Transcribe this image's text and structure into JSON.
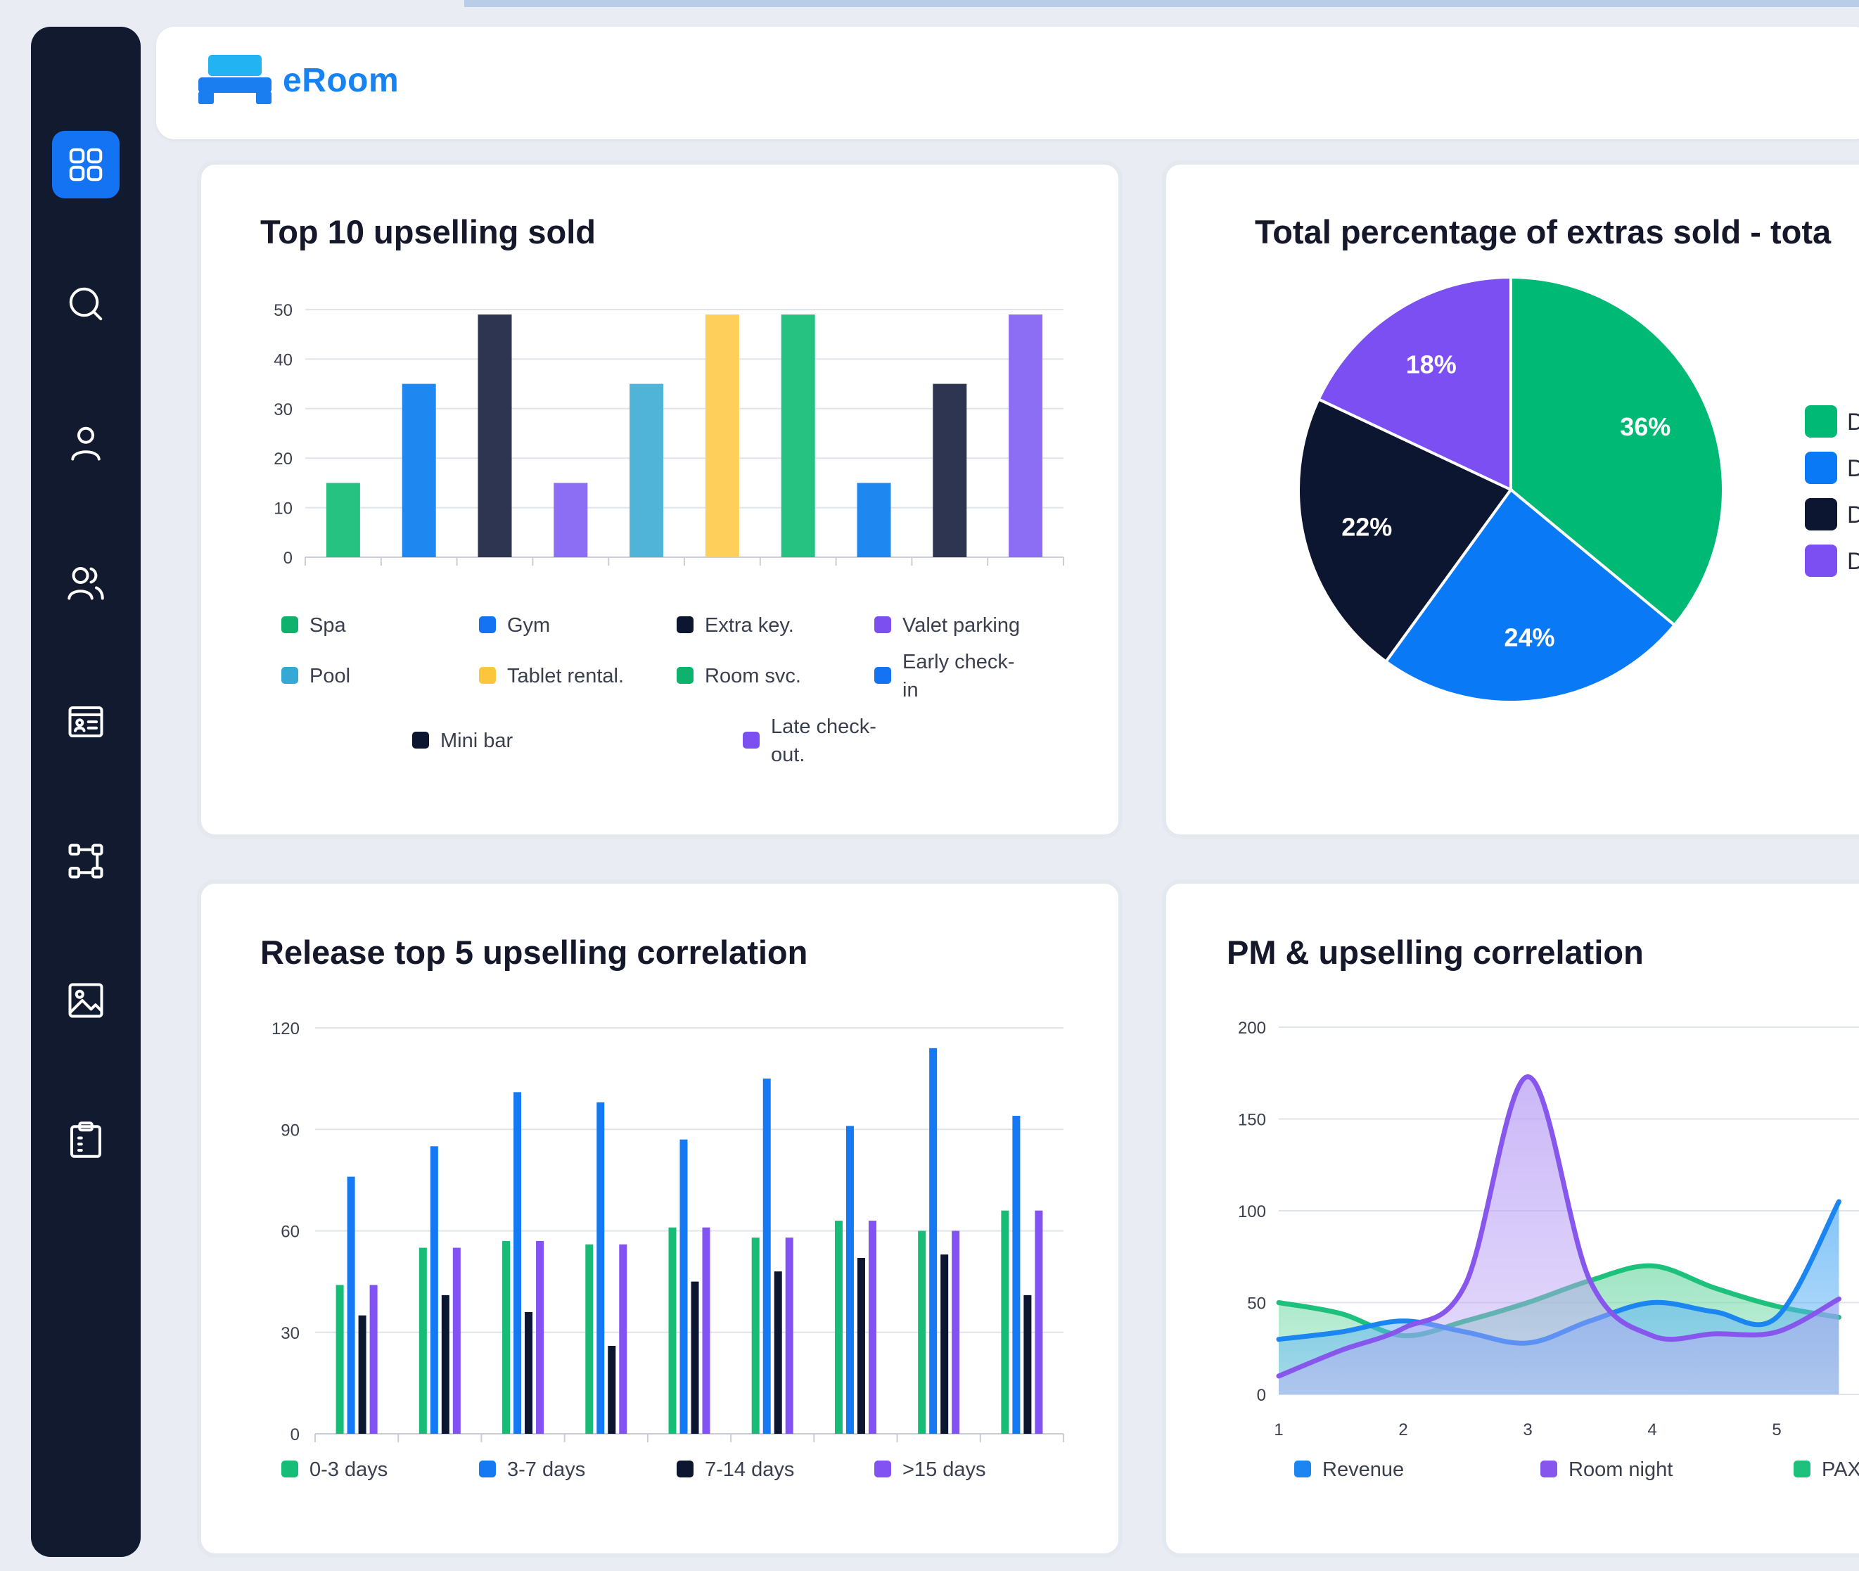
{
  "app": {
    "name": "eRoom"
  },
  "sidebar": {
    "items": [
      {
        "icon": "dashboard-icon",
        "active": true
      },
      {
        "icon": "search-icon"
      },
      {
        "icon": "user-icon"
      },
      {
        "icon": "users-icon"
      },
      {
        "icon": "id-card-icon"
      },
      {
        "icon": "workflow-icon"
      },
      {
        "icon": "image-icon"
      },
      {
        "icon": "clipboard-icon"
      }
    ]
  },
  "colors": {
    "accent": "#1473f2",
    "sidebar": "#111a2e",
    "green": "#26c281",
    "blue": "#1e88f0",
    "navy": "#2d3550",
    "purple": "#8c6ef5",
    "teal": "#4fb4d8",
    "yellow": "#fecf5a"
  },
  "cards": {
    "top10": {
      "title": "Top 10 upselling sold"
    },
    "extras": {
      "title": "Total percentage of extras sold - tota"
    },
    "release": {
      "title": "Release top 5 upselling correlation"
    },
    "pm": {
      "title": "PM & upselling correlation"
    }
  },
  "chart_data": [
    {
      "type": "bar",
      "title": "Top 10 upselling sold",
      "categories": [
        "Spa",
        "Gym",
        "Extra key.",
        "Valet parking",
        "Pool",
        "Tablet rental.",
        "Room svc.",
        "Early check-in",
        "Mini bar",
        "Late check-out."
      ],
      "values": [
        15,
        35,
        49,
        15,
        35,
        49,
        49,
        15,
        35,
        49
      ],
      "colors": [
        "#26c281",
        "#1e88f0",
        "#2d3550",
        "#8c6ef5",
        "#4fb4d8",
        "#fecf5a",
        "#26c281",
        "#1e88f0",
        "#2d3550",
        "#8c6ef5"
      ],
      "yticks": [
        "0",
        "10",
        "20",
        "30",
        "40",
        "50"
      ],
      "ylim": [
        0,
        50
      ],
      "grid": true,
      "legend": [
        {
          "label": "Spa",
          "color": "#0fb26c"
        },
        {
          "label": "Gym",
          "color": "#1473f2"
        },
        {
          "label": "Extra key.",
          "color": "#0d1630"
        },
        {
          "label": "Valet parking",
          "color": "#7c4ff0"
        },
        {
          "label": "Pool",
          "color": "#35a8d6"
        },
        {
          "label": "Tablet rental.",
          "color": "#fbc63c"
        },
        {
          "label": "Room svc.",
          "color": "#0fb26c"
        },
        {
          "label": "Early check-",
          "label2": "in",
          "color": "#1473f2"
        },
        {
          "label": "Mini bar",
          "color": "#0d1630"
        },
        {
          "label": "Late check-",
          "label2": "out.",
          "color": "#7c4ff0"
        }
      ]
    },
    {
      "type": "pie",
      "title": "Total percentage of extras sold - tota",
      "slices": [
        {
          "label": "36%",
          "value": 36,
          "color": "#00b975"
        },
        {
          "label": "24%",
          "value": 24,
          "color": "#0a79f5"
        },
        {
          "label": "22%",
          "value": 22,
          "color": "#0d1630"
        },
        {
          "label": "18%",
          "value": 18,
          "color": "#7b4ff1"
        }
      ],
      "legend": [
        {
          "label": "D",
          "color": "#00b975"
        },
        {
          "label": "D",
          "color": "#0a79f5"
        },
        {
          "label": "D",
          "color": "#0d1630"
        },
        {
          "label": "D",
          "color": "#7b4ff1"
        }
      ]
    },
    {
      "type": "bar",
      "title": "Release top 5 upselling correlation",
      "groups": 9,
      "series": [
        {
          "name": "0-3 days",
          "color": "#17bd76",
          "values": [
            44,
            55,
            57,
            56,
            61,
            58,
            63,
            60,
            66
          ]
        },
        {
          "name": "3-7 days",
          "color": "#1479f2",
          "values": [
            76,
            85,
            101,
            98,
            87,
            105,
            91,
            114,
            94
          ]
        },
        {
          "name": "7-14 days",
          "color": "#0d1630",
          "values": [
            35,
            41,
            36,
            26,
            45,
            48,
            52,
            53,
            41
          ]
        },
        {
          "name": ">15 days",
          "color": "#8352f2",
          "values": [
            44,
            55,
            57,
            56,
            61,
            58,
            63,
            60,
            66
          ]
        }
      ],
      "yticks": [
        "0",
        "30",
        "60",
        "90",
        "120"
      ],
      "ylim": [
        0,
        120
      ],
      "grid": true
    },
    {
      "type": "area",
      "title": "PM & upselling correlation",
      "x": [
        1,
        1.5,
        2,
        2.5,
        3,
        3.5,
        4,
        4.5,
        5,
        5.5
      ],
      "xticks": [
        "1",
        "2",
        "3",
        "4",
        "5"
      ],
      "yticks": [
        "0",
        "50",
        "100",
        "150",
        "200"
      ],
      "ylim": [
        0,
        200
      ],
      "series": [
        {
          "name": "Revenue",
          "color": "#1b86f2",
          "fill": "#5ab0f5",
          "values": [
            30,
            34,
            40,
            34,
            28,
            40,
            50,
            45,
            42,
            105
          ]
        },
        {
          "name": "Room night",
          "color": "#8756ec",
          "fill": "#b9a0f5",
          "values": [
            10,
            24,
            36,
            60,
            173,
            62,
            32,
            33,
            34,
            52
          ]
        },
        {
          "name": "PAX",
          "color": "#1ec17b",
          "fill": "#7fdcb0",
          "values": [
            50,
            44,
            32,
            40,
            50,
            62,
            70,
            58,
            48,
            42
          ]
        }
      ]
    }
  ]
}
